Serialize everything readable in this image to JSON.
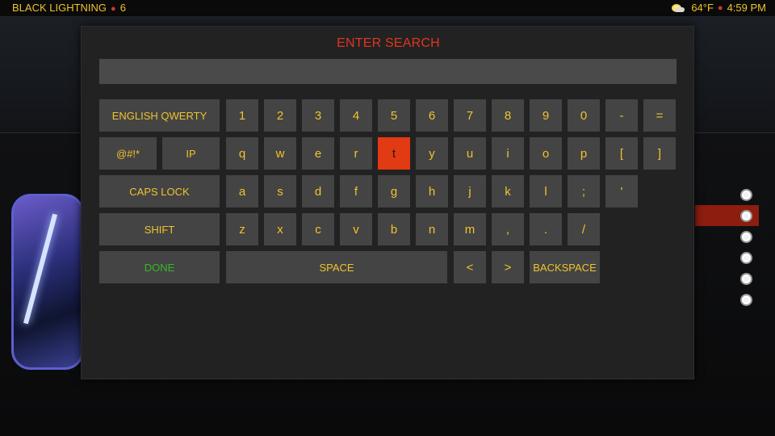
{
  "header": {
    "title": "BLACK LIGHTNING",
    "count": "6",
    "temperature": "64°F",
    "time": "4:59 PM",
    "weather_icon": "partly-sunny-icon"
  },
  "dialog": {
    "title": "ENTER SEARCH",
    "search_value": "",
    "keyboard": {
      "row1": [
        "ENGLISH QWERTY",
        "1",
        "2",
        "3",
        "4",
        "5",
        "6",
        "7",
        "8",
        "9",
        "0",
        "-",
        "="
      ],
      "row2": [
        "@#!*",
        "IP",
        "q",
        "w",
        "e",
        "r",
        "t",
        "y",
        "u",
        "i",
        "o",
        "p",
        "[",
        "]"
      ],
      "row3": [
        "CAPS LOCK",
        "a",
        "s",
        "d",
        "f",
        "g",
        "h",
        "j",
        "k",
        "l",
        ";",
        "'"
      ],
      "row4": [
        "SHIFT",
        "z",
        "x",
        "c",
        "v",
        "b",
        "n",
        "m",
        ",",
        ".",
        "/"
      ],
      "row5": [
        "DONE",
        "SPACE",
        "<",
        ">",
        "BACKSPACE"
      ],
      "focused_key": "t"
    }
  },
  "side_rail": {
    "radio_count": 6,
    "selected_index": 1
  },
  "colors": {
    "accent_yellow": "#f0c32c",
    "accent_red": "#e23a12",
    "done_green": "#35b82a",
    "title_red": "#e2351d",
    "key_bg": "#444444"
  }
}
